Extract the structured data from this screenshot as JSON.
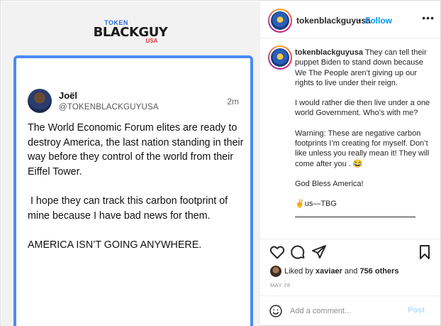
{
  "post_image": {
    "brand": {
      "top": "TOKEN",
      "main": "BLACKGUY",
      "sub": "USA"
    },
    "tweet": {
      "name": "Joël",
      "handle": "@TOKENBLACKGUYUSA",
      "time": "2m",
      "paragraphs": [
        "The World Economic Forum elites are ready to destroy America, the last nation standing in their way before they control of the world from their Eiffel Tower.",
        " I hope they can track this carbon footprint of mine because I have bad news for them.",
        "AMERICA ISN’T GOING ANYWHERE."
      ]
    }
  },
  "header": {
    "username": "tokenblackguyusa",
    "separator": "•",
    "follow_label": "Follow",
    "more_label": "•••"
  },
  "caption": {
    "username": "tokenblackguyusa",
    "paragraphs": [
      "They can tell their puppet Biden to stand down because We The People aren’t giving up our rights to live under their reign.",
      "I would rather die then live under a one world Government. Who’s with me?",
      "Warning: These are negative carbon footprints I’m creating for myself. Don’t like unless you really mean it! They will come after you . 😂",
      "God Bless America!",
      "✌us—TBG"
    ]
  },
  "likes": {
    "prefix": "Liked by ",
    "user": "xaviaer",
    "middle": " and ",
    "count": "756 others"
  },
  "date": "MAY 28",
  "comment": {
    "placeholder": "Add a comment...",
    "post_label": "Post"
  },
  "icons": [
    "heart-icon",
    "comment-icon",
    "share-icon",
    "bookmark-icon",
    "emoji-icon",
    "more-icon"
  ],
  "colors": {
    "accent": "#0095f6",
    "card_border": "#4a8cf1",
    "post_disabled": "#b2dffc"
  }
}
